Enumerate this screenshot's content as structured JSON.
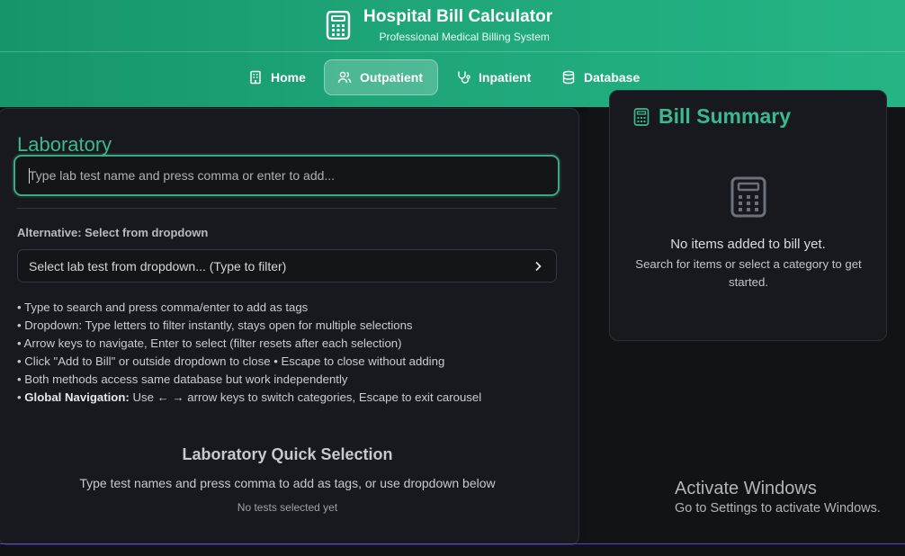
{
  "header": {
    "title": "Hospital Bill Calculator",
    "subtitle": "Professional Medical Billing System",
    "icon": "calculator-icon"
  },
  "nav": {
    "items": [
      {
        "label": "Home",
        "icon": "building-icon",
        "active": false
      },
      {
        "label": "Outpatient",
        "icon": "users-icon",
        "active": true
      },
      {
        "label": "Inpatient",
        "icon": "stethoscope-icon",
        "active": false
      },
      {
        "label": "Database",
        "icon": "database-icon",
        "active": false
      }
    ]
  },
  "laboratory": {
    "title": "Laboratory",
    "tag_input_placeholder": "Type lab test name and press comma or enter to add...",
    "alt_label": "Alternative: Select from dropdown",
    "dropdown_placeholder": "Select lab test from dropdown... (Type to filter)",
    "instructions": [
      "• Type to search and press comma/enter to add as tags",
      "• Dropdown: Type letters to filter instantly, stays open for multiple selections",
      "• Arrow keys to navigate, Enter to select (filter resets after each selection)",
      "• Click \"Add to Bill\" or outside dropdown to close • Escape to close without adding",
      "• Both methods access same database but work independently"
    ],
    "global_nav_prefix": "• ",
    "global_nav_label": "Global Navigation:",
    "global_nav_text": " Use ← → arrow keys to switch categories, Escape to exit carousel",
    "quick_title": "Laboratory Quick Selection",
    "quick_subtitle": "Type test names and press comma to add as tags, or use dropdown below",
    "quick_empty": "No tests selected yet"
  },
  "summary": {
    "title": "Bill Summary",
    "empty_main": "No items added to bill yet.",
    "empty_sub": "Search for items or select a category to get started."
  },
  "watermark": {
    "title": "Activate Windows",
    "subtitle": "Go to Settings to activate Windows."
  },
  "colors": {
    "accent": "#3cb890",
    "header_green": "#1fa77a",
    "background": "#111216",
    "panel": "#18191e"
  }
}
